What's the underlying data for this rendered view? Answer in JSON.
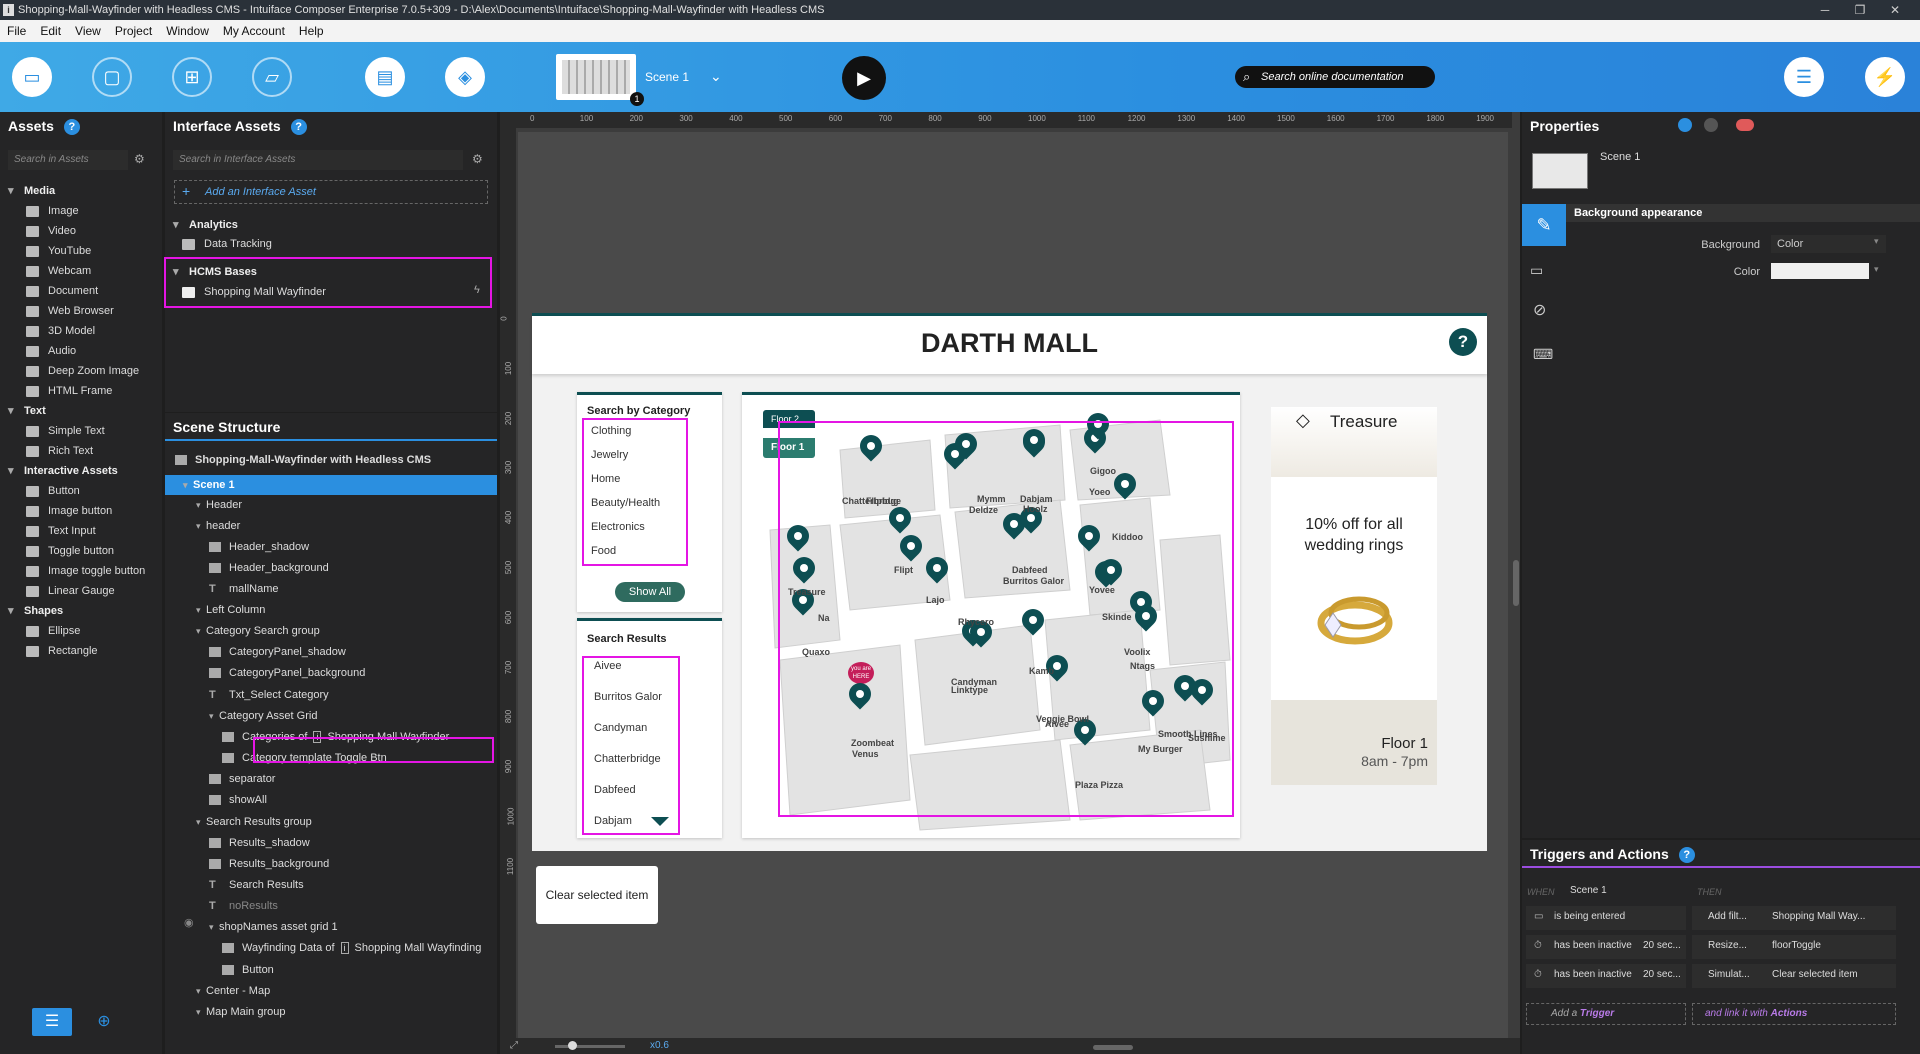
{
  "window": {
    "title": "Shopping-Mall-Wayfinder with Headless CMS - Intuiface Composer Enterprise 7.0.5+309 - D:\\Alex\\Documents\\Intuiface\\Shopping-Mall-Wayfinder with Headless CMS",
    "minimize": "─",
    "maximize": "❐",
    "close": "✕"
  },
  "menu": [
    "File",
    "Edit",
    "View",
    "Project",
    "Window",
    "My Account",
    "Help"
  ],
  "toolbar": {
    "scene_name": "Scene 1",
    "scene_count": "1",
    "search_placeholder": "Search online documentation"
  },
  "assets": {
    "title": "Assets",
    "search": "Search in Assets",
    "sections": [
      {
        "name": "Media",
        "items": [
          "Image",
          "Video",
          "YouTube",
          "Webcam",
          "Document",
          "Web Browser",
          "3D Model",
          "Audio",
          "Deep Zoom Image",
          "HTML Frame"
        ]
      },
      {
        "name": "Text",
        "items": [
          "Simple Text",
          "Rich Text"
        ]
      },
      {
        "name": "Interactive Assets",
        "items": [
          "Button",
          "Image button",
          "Text Input",
          "Toggle button",
          "Image toggle button",
          "Linear Gauge"
        ]
      },
      {
        "name": "Shapes",
        "items": [
          "Ellipse",
          "Rectangle"
        ]
      }
    ]
  },
  "interface_assets": {
    "title": "Interface Assets",
    "search": "Search in Interface Assets",
    "add": "Add an Interface Asset",
    "analytics": "Analytics",
    "data_tracking": "Data Tracking",
    "hcms": "HCMS Bases",
    "hcms_item": "Shopping Mall Wayfinder"
  },
  "scene_structure": {
    "title": "Scene Structure",
    "root": "Shopping-Mall-Wayfinder with Headless CMS",
    "rows": [
      "Scene 1",
      "Header",
      "header",
      "Header_shadow",
      "Header_background",
      "mallName",
      "Left Column",
      "Category Search group",
      "CategoryPanel_shadow",
      "CategoryPanel_background",
      "Txt_Select Category",
      "Category Asset Grid",
      "Categories of",
      "Shopping Mall Wayfinder",
      "Category template Toggle Btn",
      "separator",
      "showAll",
      "Search Results group",
      "Results_shadow",
      "Results_background",
      "Search Results",
      "noResults",
      "shopNames asset grid 1",
      "Wayfinding Data of",
      "Shopping Mall Wayfinding",
      "Button",
      "Center - Map",
      "Map Main group"
    ]
  },
  "ruler": {
    "top": [
      "0",
      "100",
      "200",
      "300",
      "400",
      "500",
      "600",
      "700",
      "800",
      "900",
      "1000",
      "1100",
      "1200",
      "1300",
      "1400",
      "1500",
      "1600",
      "1700",
      "1800",
      "1900"
    ],
    "left": [
      "0",
      "100",
      "200",
      "300",
      "400",
      "500",
      "600",
      "700",
      "800",
      "900",
      "1000",
      "1100"
    ]
  },
  "canvas": {
    "mall_name": "DARTH MALL",
    "help": "?",
    "category_title": "Search by Category",
    "categories": [
      "Clothing",
      "Jewelry",
      "Home",
      "Beauty/Health",
      "Electronics",
      "Food"
    ],
    "show_all": "Show All",
    "results_title": "Search Results",
    "results": [
      "Aivee",
      "Burritos Galor",
      "Candyman",
      "Chatterbridge",
      "Dabfeed",
      "Dabjam"
    ],
    "floor2": "Floor 2",
    "floor1": "Floor 1",
    "you_are_here": "you are HERE",
    "stores": [
      "Chatterbridge",
      "Flipbug",
      "Mymm",
      "Deldze",
      "Dabjam",
      "Hoolz",
      "Gigoo",
      "Yoeo",
      "Kiddoo",
      "Treasure",
      "Flipt",
      "Lajo",
      "Dabfeed",
      "Burritos Galor",
      "Yovee",
      "Na",
      "Rhycero",
      "Skinde",
      "Quaxo",
      "Candyman",
      "Linktype",
      "Kamb",
      "Voolix",
      "Ntags",
      "Veggie Bowl",
      "Aivee",
      "Smooth Lines",
      "Sushime",
      "My Burger",
      "Zoombeat",
      "Venus",
      "Plaza Pizza"
    ],
    "promo": {
      "brand": "Treasure",
      "offer": "10% off for all wedding rings",
      "floor": "Floor 1",
      "hours": "8am - 7pm"
    },
    "clear_btn": "Clear selected item",
    "zoom": "x0.6"
  },
  "properties": {
    "title": "Properties",
    "scene": "Scene 1",
    "section": "Background appearance",
    "background_label": "Background",
    "background_value": "Color",
    "color_label": "Color"
  },
  "triggers": {
    "title": "Triggers and Actions",
    "when": "WHEN",
    "then": "THEN",
    "scene": "Scene 1",
    "rows": [
      {
        "trigger": "is being entered",
        "param": "",
        "action": "Add filt...",
        "target": "Shopping Mall Way..."
      },
      {
        "trigger": "has been inactive",
        "param": "20 sec...",
        "action": "Resize...",
        "target": "floorToggle"
      },
      {
        "trigger": "has been inactive",
        "param": "20 sec...",
        "action": "Simulat...",
        "target": "Clear selected item"
      }
    ],
    "add_trigger_prefix": "Add a",
    "add_trigger": "Trigger",
    "link_prefix": "and link it with",
    "link": "Actions"
  },
  "colors": {
    "accent": "#2b8fe0",
    "teal": "#0d4e52",
    "magenta": "#e415e4",
    "promo_bg": "#e7e4dc"
  }
}
